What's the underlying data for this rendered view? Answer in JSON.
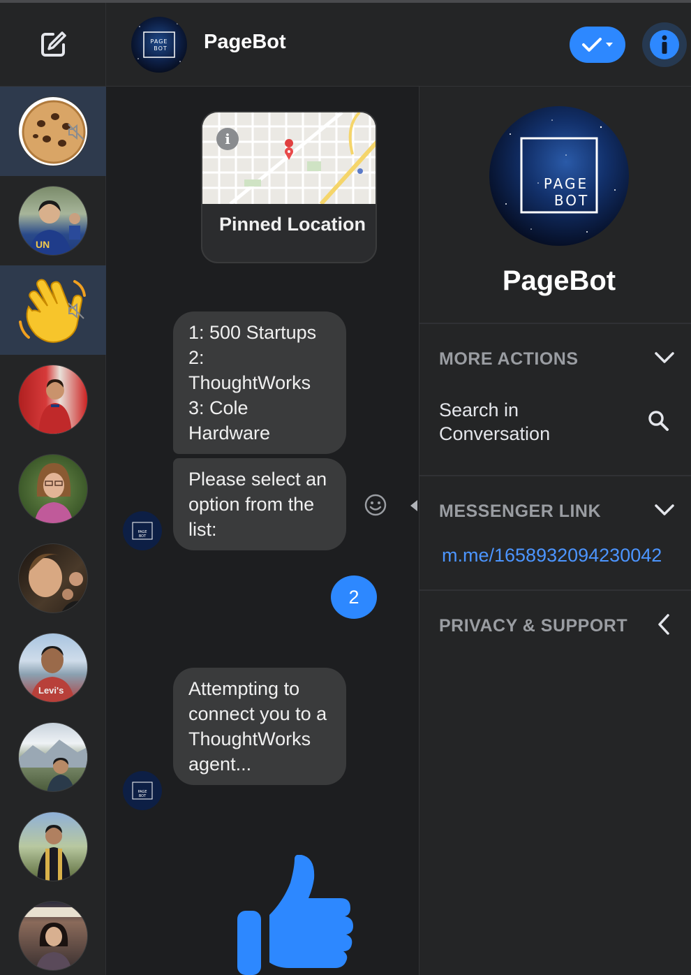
{
  "header": {
    "contact_name": "PageBot",
    "avatar_text_line1": "PAGE",
    "avatar_text_line2": "BOT"
  },
  "rail": {
    "conversations": [
      {
        "id": "cookie",
        "icon": "cookie-icon",
        "muted": true,
        "selected": true
      },
      {
        "id": "person-1",
        "muted": false,
        "selected": false
      },
      {
        "id": "wave",
        "icon": "waving-hand-icon",
        "muted": true,
        "selected": true
      },
      {
        "id": "person-2",
        "muted": false,
        "selected": false
      },
      {
        "id": "person-3",
        "muted": false,
        "selected": false
      },
      {
        "id": "person-4",
        "muted": false,
        "selected": false
      },
      {
        "id": "person-5",
        "muted": false,
        "selected": false
      },
      {
        "id": "person-6",
        "muted": false,
        "selected": false
      },
      {
        "id": "person-7",
        "muted": false,
        "selected": false
      },
      {
        "id": "person-8",
        "muted": false,
        "selected": false
      }
    ]
  },
  "chat": {
    "pinned_location": "Pinned Location",
    "messages": [
      {
        "text": "1: 500 Startups 2: ThoughtWorks 3: Cole Hardware"
      },
      {
        "text": "Please select an option from the list:"
      },
      {
        "text": "Attempting to connect you to a ThoughtWorks agent..."
      }
    ],
    "sent_count": "2",
    "thumbs_up_color": "#2d88ff"
  },
  "panel": {
    "name": "PageBot",
    "sections": {
      "more_actions": "MORE ACTIONS",
      "messenger_link": "MESSENGER LINK",
      "privacy_support": "PRIVACY & SUPPORT"
    },
    "search_label": "Search in Conversation",
    "link": "m.me/1658932094230042"
  },
  "colors": {
    "accent": "#2d88ff",
    "link": "#4c95ff",
    "bubble": "#3a3b3c",
    "background": "#1d1e20"
  }
}
